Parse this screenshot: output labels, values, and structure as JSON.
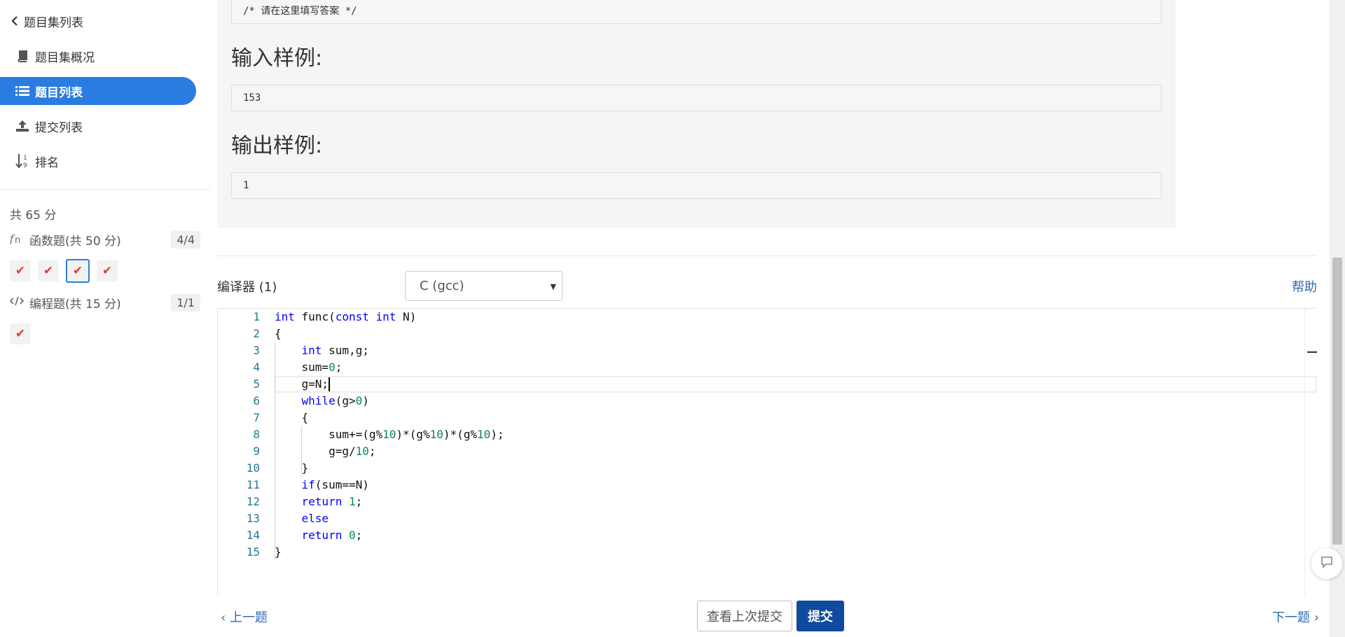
{
  "sidebar": {
    "back_label": "题目集列表",
    "items": [
      {
        "label": "题目集概况",
        "icon": "book-icon"
      },
      {
        "label": "题目列表",
        "icon": "list-icon",
        "active": true
      },
      {
        "label": "提交列表",
        "icon": "upload-icon"
      },
      {
        "label": "排名",
        "icon": "sort-numeric-icon"
      }
    ],
    "total_score": "共 65 分",
    "categories": [
      {
        "label": "函数题(共 50 分)",
        "icon": "function-icon",
        "count": "4/4",
        "problems": 4,
        "active_index": 2
      },
      {
        "label": "编程题(共 15 分)",
        "icon": "code-icon",
        "count": "1/1",
        "problems": 1
      }
    ],
    "check_mark": "✔"
  },
  "problem": {
    "answer_placeholder": "/* 请在这里填写答案 */",
    "sample_input_title": "输入样例:",
    "sample_input": "153",
    "sample_output_title": "输出样例:",
    "sample_output": "1"
  },
  "editor_bar": {
    "compiler_label": "编译器 (1)",
    "language": "C (gcc)",
    "help_label": "帮助"
  },
  "editor": {
    "cursor_line": 5,
    "lines": [
      "int func(const int N)",
      "{",
      "    int sum,g;",
      "    sum=0;",
      "    g=N;",
      "    while(g>0)",
      "    {",
      "        sum+=(g%10)*(g%10)*(g%10);",
      "        g=g/10;",
      "    }",
      "    if(sum==N)",
      "    return 1;",
      "    else",
      "    return 0;",
      "}"
    ]
  },
  "footer": {
    "prev_label": "上一题",
    "view_last_label": "查看上次提交",
    "submit_label": "提交",
    "next_label": "下一题"
  },
  "colors": {
    "accent": "#2a7ce0",
    "submit": "#0e4a9e",
    "check": "#e53935",
    "keyword": "#0000ff",
    "number": "#098658",
    "line_number": "#237893"
  }
}
